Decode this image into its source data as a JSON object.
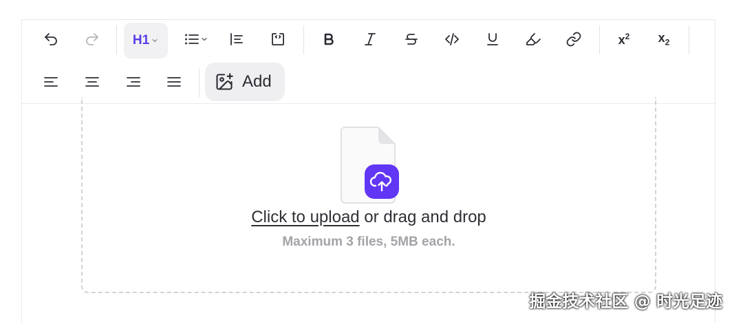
{
  "toolbar": {
    "heading_label": "H1",
    "superscript_label": "x",
    "superscript_mark": "2",
    "subscript_label": "x",
    "subscript_mark": "2",
    "add_label": "Add"
  },
  "upload": {
    "link_text": "Click to upload",
    "rest_text": " or drag and drop",
    "hint": "Maximum 3 files, 5MB each."
  },
  "watermark": "掘金技术社区 @ 时光足迹",
  "colors": {
    "accent": "#5b3ce6",
    "upload_badge": "#6236f5"
  }
}
